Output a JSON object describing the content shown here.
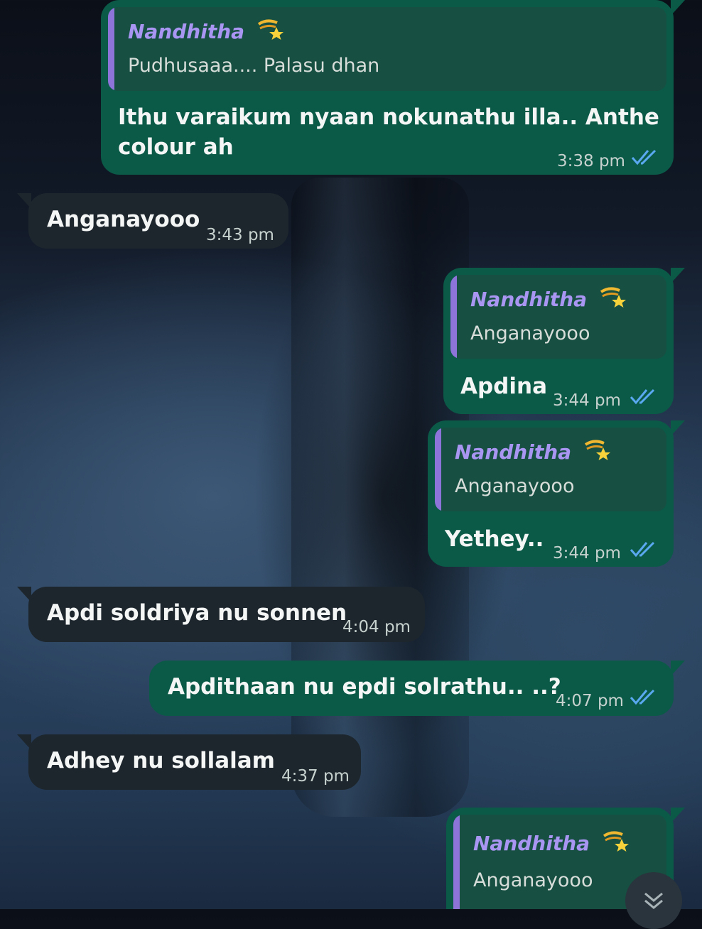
{
  "reply_name": "Nandhitha",
  "messages": [
    {
      "quote_text": "Pudhusaaa.... Palasu dhan",
      "line1": "Ithu varaikum nyaan nokunathu illa.. Anthe",
      "line2": "colour ah",
      "time": "3:38 pm"
    },
    {
      "text": "Anganayooo",
      "time": "3:43 pm"
    },
    {
      "quote_text": "Anganayooo",
      "text": "Apdina",
      "time": "3:44 pm"
    },
    {
      "quote_text": "Anganayooo",
      "text": "Yethey..",
      "time": "3:44 pm"
    },
    {
      "text": "Apdi soldriya nu sonnen",
      "time": "4:04 pm"
    },
    {
      "text": "Apdithaan nu epdi solrathu.. ..?",
      "time": "4:07 pm"
    },
    {
      "text": "Adhey nu sollalam",
      "time": "4:37 pm"
    },
    {
      "quote_text": "Anganayooo"
    }
  ],
  "colors": {
    "outgoing": "#0b5a48",
    "incoming": "#1d262d",
    "quote_bar": "#8d74d9",
    "read_ticks": "#5aa8f0"
  },
  "icons": {
    "reply_emoji": "shooting-star-icon",
    "read_receipt": "double-check-icon",
    "scroll_down": "chevron-double-down-icon"
  }
}
